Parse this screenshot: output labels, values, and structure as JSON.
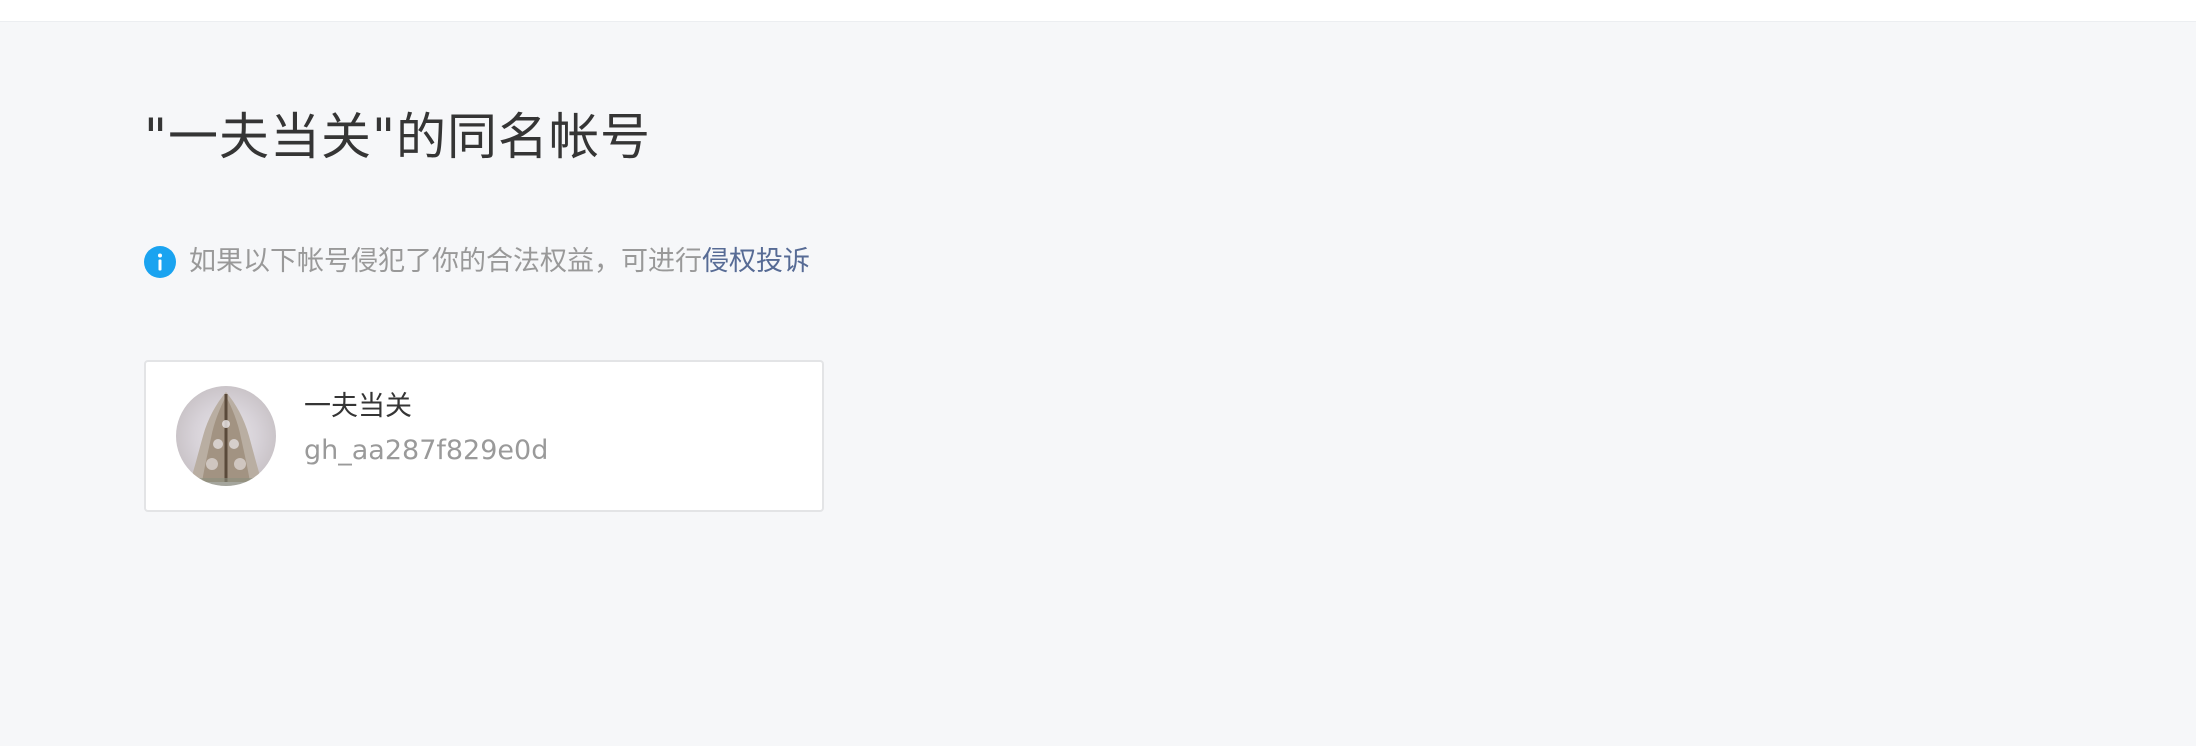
{
  "page": {
    "title": "\"一夫当关\"的同名帐号"
  },
  "notice": {
    "icon": "info-icon",
    "text": "如果以下帐号侵犯了你的合法权益，可进行",
    "link_label": "侵权投诉",
    "accent_color": "#1aa3f0",
    "link_color": "#576b95"
  },
  "accounts": [
    {
      "name": "一夫当关",
      "id": "gh_aa287f829e0d"
    }
  ]
}
